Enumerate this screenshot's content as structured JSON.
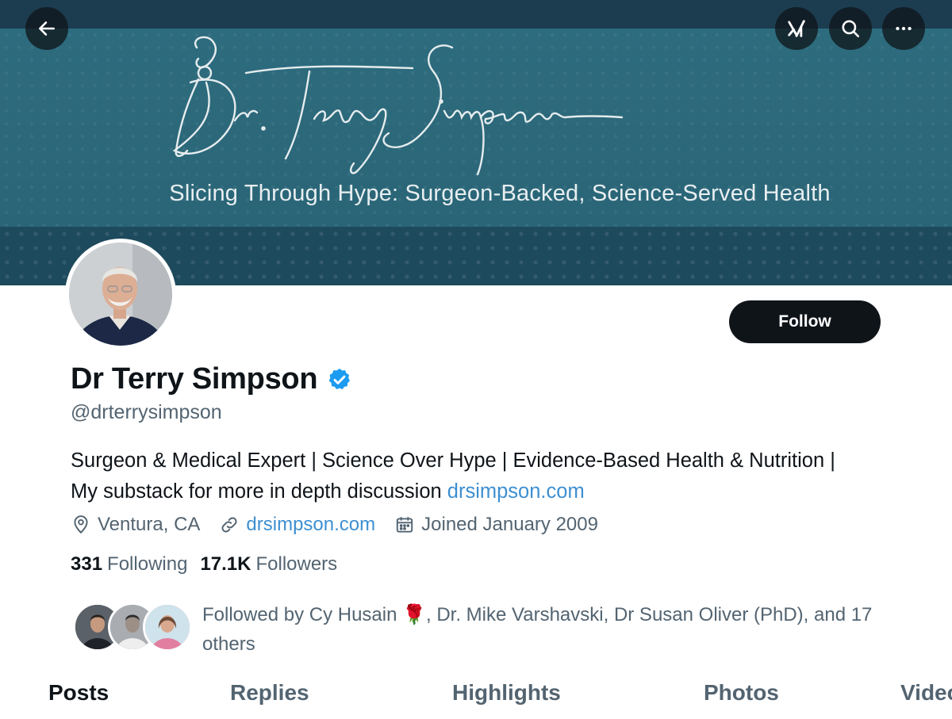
{
  "banner": {
    "signature_text": "Dr. Terry Simpson",
    "tagline": "Slicing Through Hype: Surgeon-Backed, Science-Served Health"
  },
  "nav": {
    "back_icon": "arrow-left-icon",
    "grok_icon": "grok-icon",
    "search_icon": "search-icon",
    "more_icon": "more-horizontal-icon"
  },
  "profile": {
    "name": "Dr Terry Simpson",
    "verified": true,
    "handle": "@drterrysimpson",
    "follow_label": "Follow",
    "bio_text": "Surgeon & Medical Expert | Science Over Hype | Evidence-Based Health & Nutrition | My substack for more in depth discussion ",
    "bio_link": "drsimpson.com",
    "location": "Ventura, CA",
    "website": "drsimpson.com",
    "joined": "Joined January 2009",
    "following_count": "331",
    "following_label": "Following",
    "followers_count": "17.1K",
    "followers_label": "Followers",
    "followed_by_prefix": "Followed by Cy Husain ",
    "followed_by_emoji": "🌹",
    "followed_by_rest": ", Dr. Mike Varshavski, Dr Susan Oliver (PhD), and 17 others"
  },
  "tabs": [
    {
      "label": "Posts",
      "active": true
    },
    {
      "label": "Replies",
      "active": false
    },
    {
      "label": "Highlights",
      "active": false
    },
    {
      "label": "Photos",
      "active": false
    },
    {
      "label": "Videos",
      "active": false
    }
  ],
  "colors": {
    "link": "#3d8fd1",
    "verified": "#1d9bf0",
    "banner": "#2a6577"
  }
}
